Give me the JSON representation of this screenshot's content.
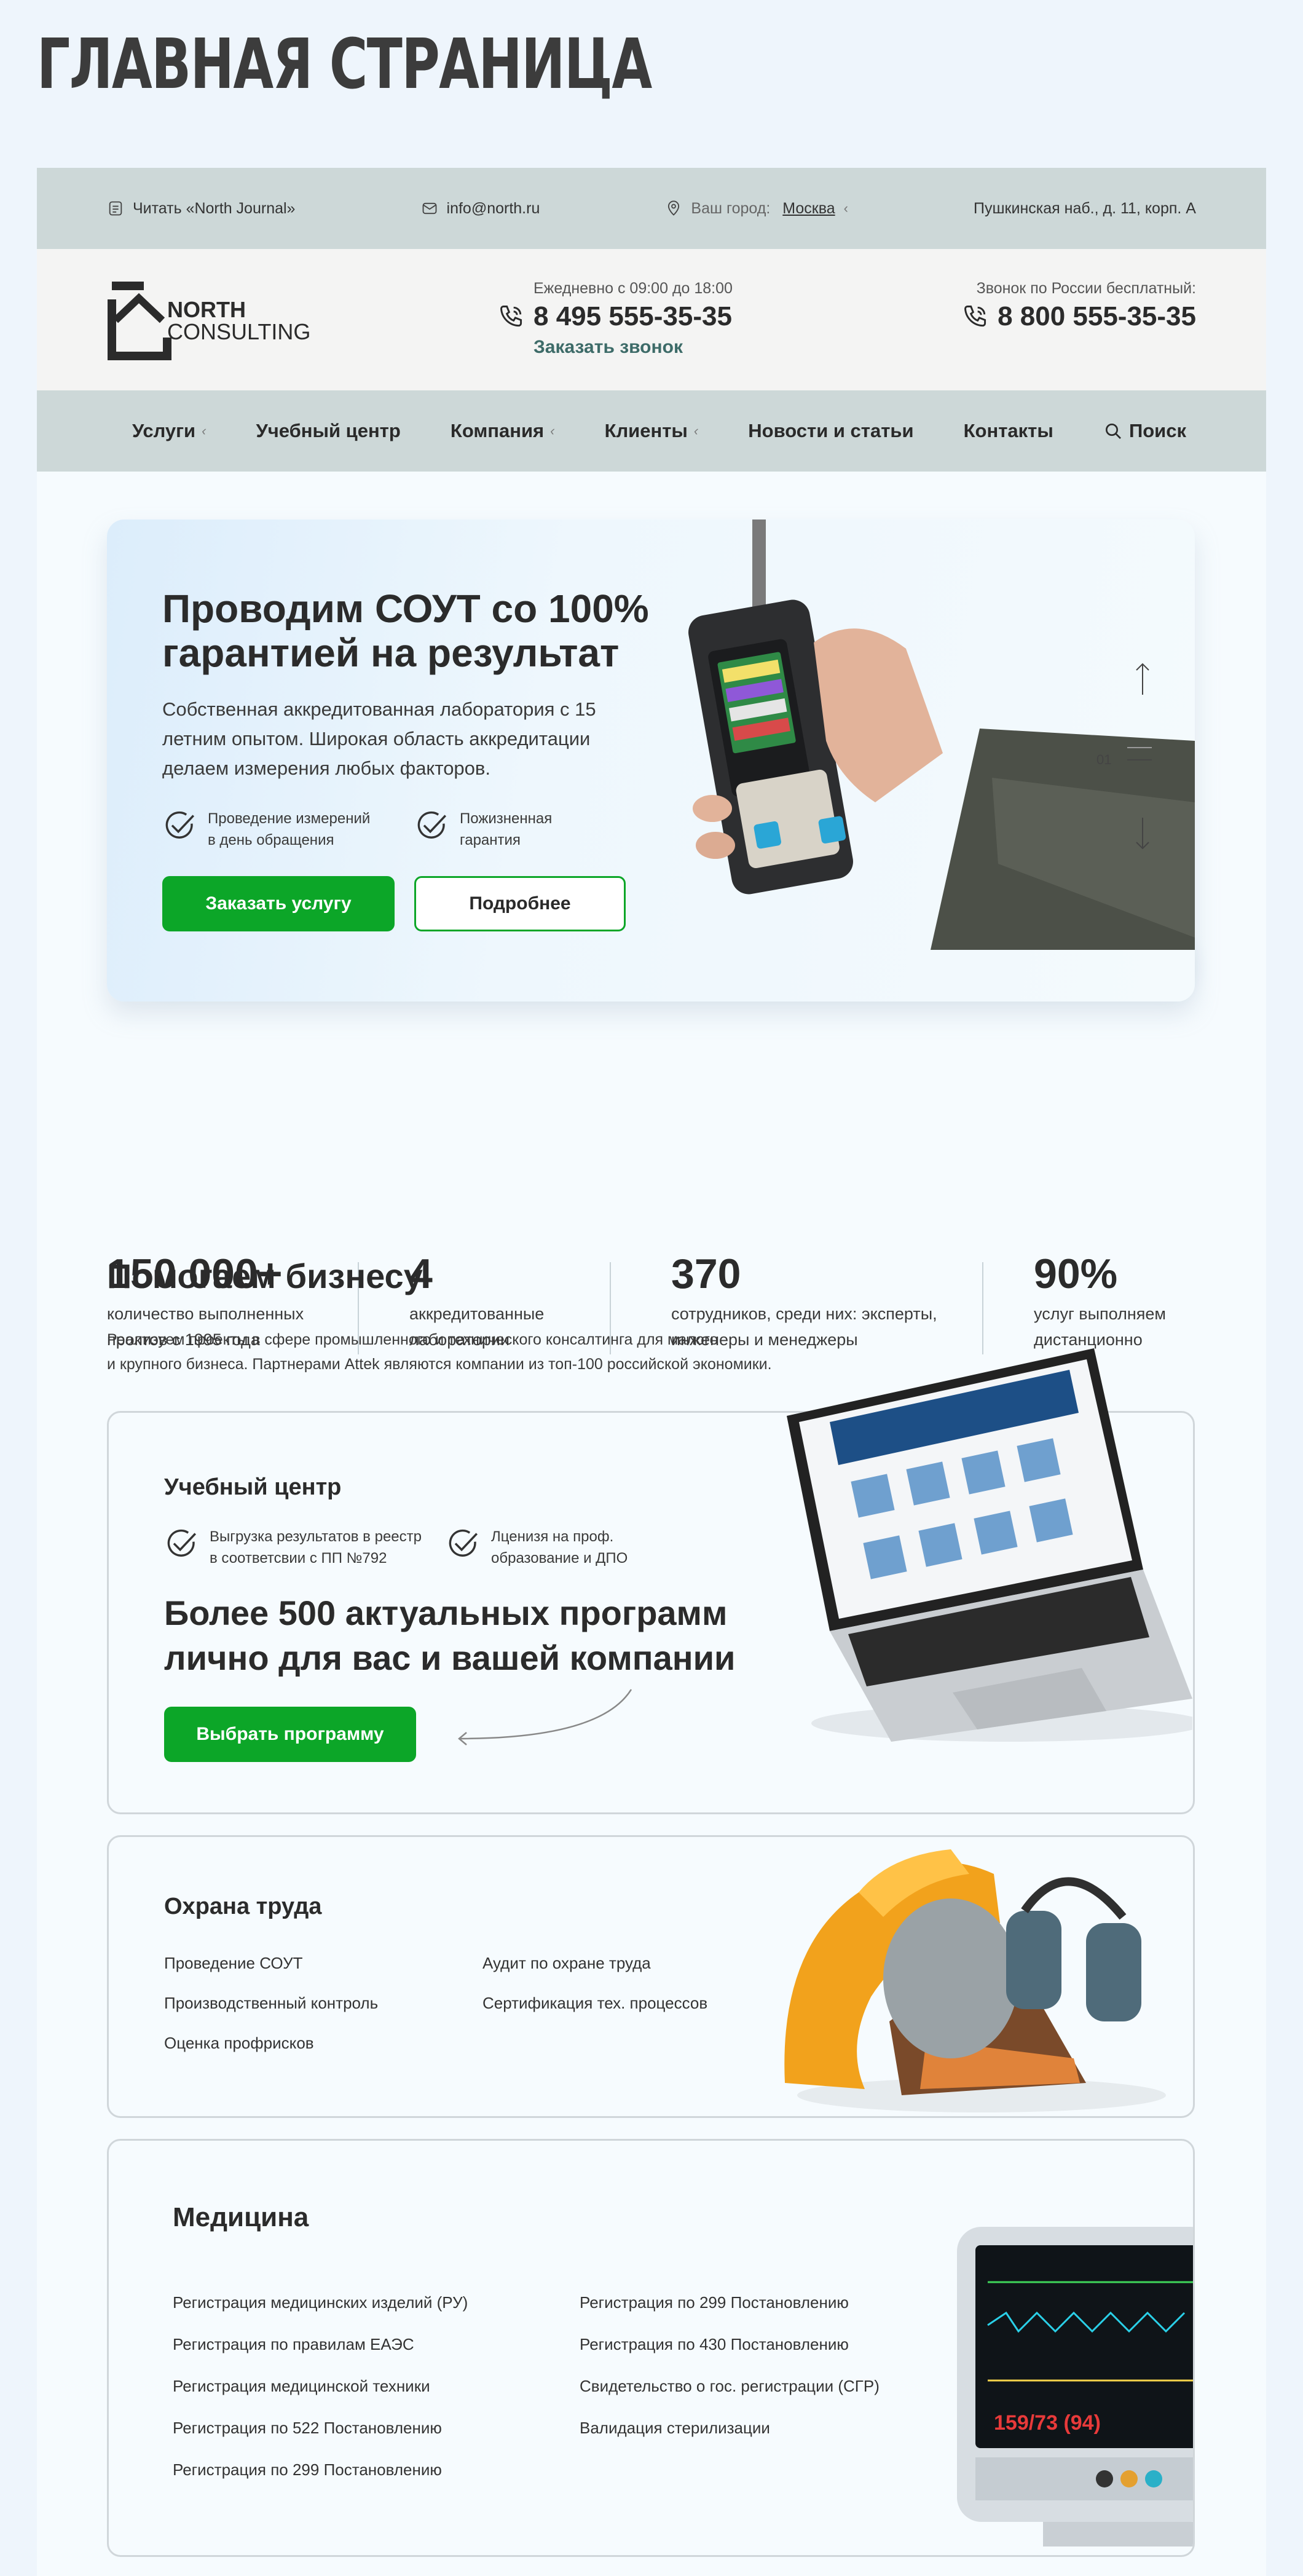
{
  "page_title": "ГЛАВНАЯ СТРАНИЦА",
  "topbar": {
    "journal": "Читать «North Journal»",
    "email": "info@north.ru",
    "city_label": "Ваш город:",
    "city": "Москва",
    "address": "Пушкинская наб., д. 11, корп. А"
  },
  "header": {
    "logo_line1": "NORTH",
    "logo_line2": "CONSULTING",
    "hours": "Ежедневно с 09:00 до 18:00",
    "phone1": "8 495 555-35-35",
    "callback": "Заказать звонок",
    "free_label": "Звонок по России бесплатный:",
    "phone2": "8 800 555-35-35"
  },
  "nav": {
    "services": "Услуги",
    "training": "Учебный центр",
    "company": "Компания",
    "clients": "Клиенты",
    "news": "Новости и статьи",
    "contacts": "Контакты",
    "search": "Поиск"
  },
  "hero": {
    "title": "Проводим СОУТ со 100% гарантией на результат",
    "text": "Собственная аккредитованная лаборатория с 15 летним опытом. Широкая область аккредитации делаем измерения любых факторов.",
    "feature1": "Проведение измерений в день обращения",
    "feature2": "Пожизненная гарантия",
    "order_button": "Заказать услугу",
    "more_button": "Подробнее",
    "slide_number": "01"
  },
  "stats": [
    {
      "num": "150 000+",
      "label": "количество выполненных проктов с 1995 года"
    },
    {
      "num": "4",
      "label": "аккредитованные лаборатории"
    },
    {
      "num": "370",
      "label": "сотрудников, среди них: эксперты, инженеры и менеджеры"
    },
    {
      "num": "90%",
      "label": "услуг выполняем дистанционно"
    }
  ],
  "business": {
    "title": "Помогаем бизнесу",
    "intro1": "Реализуем проекты в сфере промышленного и технического консалтинга для малого",
    "intro2": "и крупного бизнеса.  Партнерами Attek являются компании из топ-100 российской экономики."
  },
  "training": {
    "title": "Учебный центр",
    "feature1": "Выгрузка результатов в реестр в соответсвии с ПП №792",
    "feature2": "Лценизя на проф. образование и ДПО",
    "headline": "Более 500 актуальных программ лично для вас и вашей компании",
    "button": "Выбрать программу"
  },
  "safety": {
    "title": "Охрана труда",
    "col1": [
      "Проведение СОУТ",
      "Производственный контроль",
      "Оценка профрисков"
    ],
    "col2": [
      "Аудит по охране труда",
      "Сертификация тех. процессов"
    ]
  },
  "medicine": {
    "title": "Медицина",
    "col1": [
      "Регистрация медицинских изделий (РУ)",
      "Регистрация по правилам ЕАЭС",
      "Регистрация медицинской техники",
      "Регистрация по 522 Постановлению",
      "Регистрация по 299 Постановлению"
    ],
    "col2": [
      "Регистрация по 299 Постановлению",
      "Регистрация по 430 Постановлению",
      "Свидетельство о гос. регистрации (СГР)",
      "Валидация стерилизации"
    ],
    "monitor_reading": "159/73 (94)"
  },
  "colors": {
    "accent": "#0ca628",
    "bar": "#cdd8d8",
    "text": "#2b2b2b"
  }
}
